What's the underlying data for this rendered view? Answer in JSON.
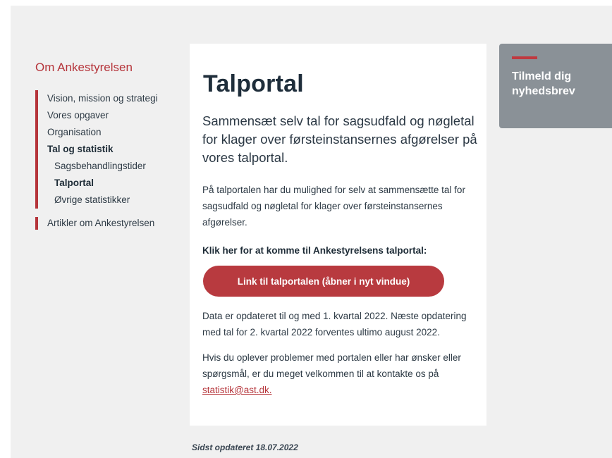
{
  "sidebar": {
    "title": "Om Ankestyrelsen",
    "items": [
      {
        "label": "Vision, mission og strategi"
      },
      {
        "label": "Vores opgaver"
      },
      {
        "label": "Organisation"
      },
      {
        "label": "Tal og statistik"
      },
      {
        "label": "Sagsbehandlingstider"
      },
      {
        "label": "Talportal"
      },
      {
        "label": "Øvrige statistikker"
      }
    ],
    "extra_item": "Artikler om Ankestyrelsen"
  },
  "main": {
    "title": "Talportal",
    "lead": "Sammensæt selv tal for sagsudfald og nøgletal for klager over førsteinstansernes afgørelser på vores talportal.",
    "paragraph1": "På talportalen har du mulighed for selv at sammensætte tal for sagsudfald og nøgletal for klager over førsteinstansernes afgørelser.",
    "cta_label": "Klik her for at komme til Ankestyrelsens talportal:",
    "cta_button": "Link til talportalen (åbner i nyt vindue)",
    "paragraph2": "Data er opdateret til og med 1. kvartal 2022. Næste opdatering med tal for 2.  kvartal 2022 forventes ultimo august 2022.",
    "paragraph3": "Hvis du oplever problemer med portalen eller har ønsker eller spørgsmål, er du meget velkommen til at kontakte os på",
    "email": "statistik@ast.dk."
  },
  "updated": "Sidst opdateret 18.07.2022",
  "newsletter": {
    "title": "Tilmeld dig nyhedsbrev"
  },
  "colors": {
    "accent": "#b5343a",
    "button": "#b83a3f",
    "newsletter_bg": "#8a9197",
    "page_bg": "#f0f0f0"
  }
}
